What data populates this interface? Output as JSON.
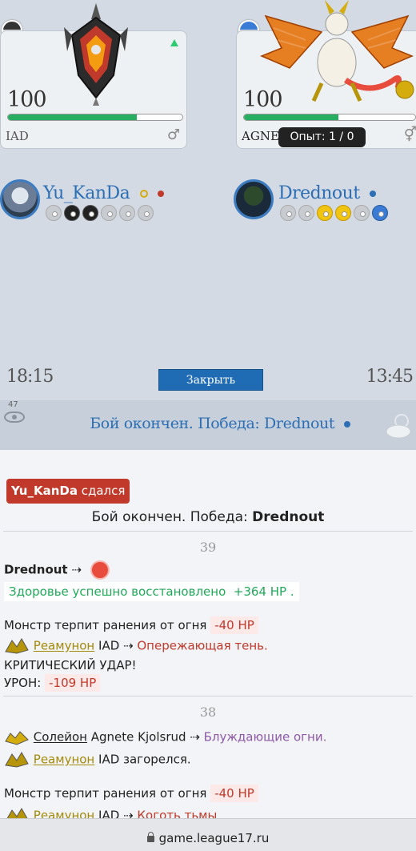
{
  "battle": {
    "left": {
      "monster": {
        "level": "100",
        "hp_fraction": 0.74,
        "name": "IAD",
        "gender": "♂"
      },
      "trainer": {
        "name": "Yu_KanDa",
        "status_color": "#c0392b"
      },
      "team_balls": [
        "grey",
        "dark",
        "dark",
        "grey",
        "grey",
        "grey"
      ]
    },
    "right": {
      "monster": {
        "level": "100",
        "hp_fraction": 0.55,
        "name": "AGNET",
        "gender": "⚥"
      },
      "trainer": {
        "name": "Drednout",
        "status_color": "#2d6fb5"
      },
      "team_balls": [
        "grey",
        "grey",
        "gold",
        "gold",
        "grey",
        "blue"
      ]
    },
    "tooltip": "Опыт: 1 / 0",
    "time_left": "18:15",
    "time_right": "13:45",
    "close_label": "Закрыть",
    "viewers": "47",
    "banner": "Бой окончен. Победа: Drednout"
  },
  "log": {
    "surrender": {
      "name": "Yu_KanDa",
      "text": " сдался"
    },
    "victory_prefix": "Бой окончен. Победа: ",
    "victory_name": "Drednout",
    "turn39": {
      "number": "39",
      "actor": "Drednout",
      "arrow": " ⇢ ",
      "heal_text": "Здоровье успешно восстановлено",
      "heal_value": "+364 HP .",
      "fire_text": "Монстр терпит ранения от огня",
      "fire_value": "-40 HP",
      "attacker": "Реамунон",
      "target": "IAD",
      "attack": "Опережающая тень.",
      "crit": "КРИТИЧЕСКИЙ УДАР!",
      "damage_label": "УРОН:",
      "damage_value": "-109 HP"
    },
    "turn38": {
      "number": "38",
      "attacker1": "Солейон",
      "target1": "Agnete Kjolsrud",
      "attack1": "Блуждающие огни.",
      "attacker2": "Реамунон",
      "burn_text": "IAD загорелся.",
      "fire_text": "Монстр терпит ранения от огня",
      "fire_value": "-40 HP",
      "attacker3": "Реамунон",
      "target3": "IAD",
      "attack3": "Коготь тьмы"
    }
  },
  "browser": {
    "url": "game.league17.ru"
  }
}
